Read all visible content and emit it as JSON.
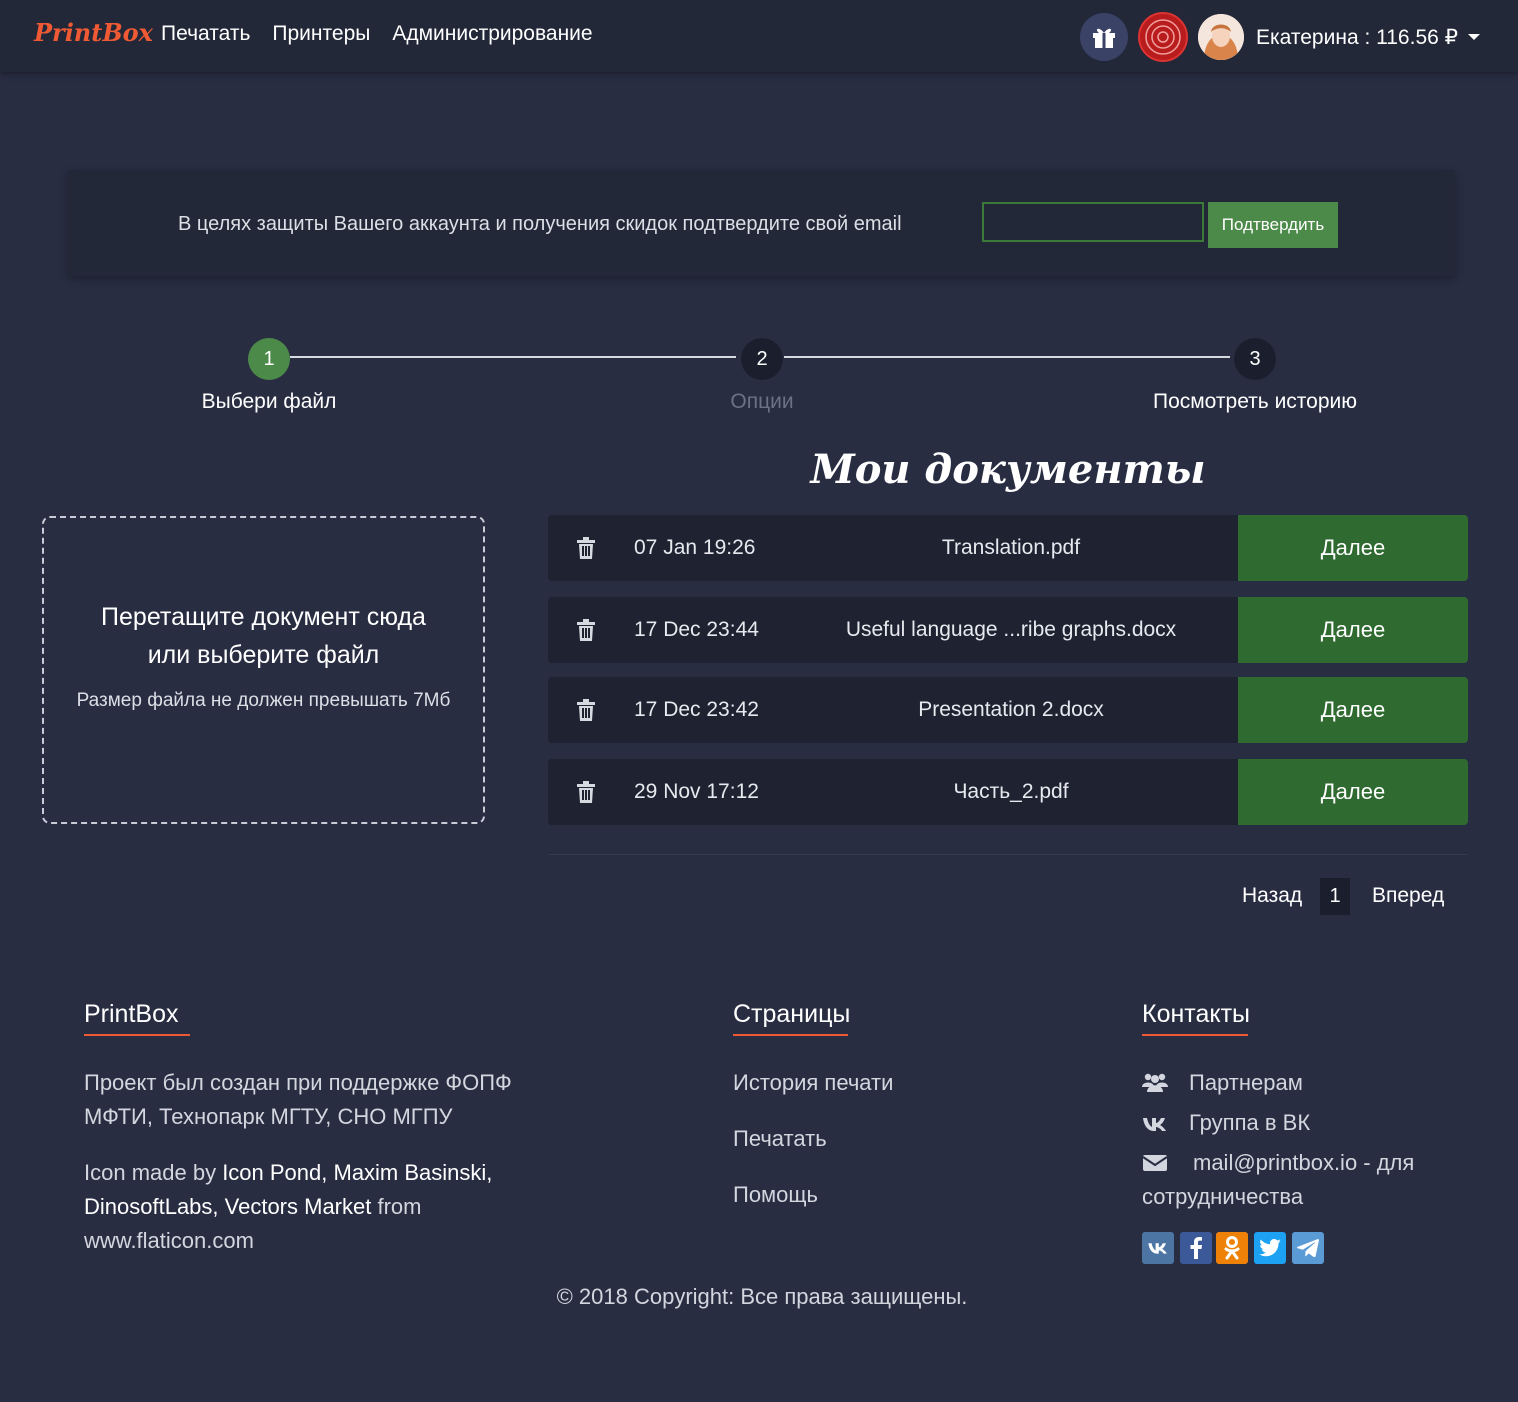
{
  "navbar": {
    "brand": "PrintBox",
    "links": [
      "Печатать",
      "Принтеры",
      "Администрирование"
    ],
    "user_label": "Екатерина : 116.56 ₽",
    "seal_text": "ТЕХНОПАРК"
  },
  "email_alert": {
    "message": "В целях защиты Вашего аккаунта и получения скидок подтвердите свой email",
    "input_value": "",
    "confirm_label": "Подтвердить"
  },
  "stepper": {
    "steps": [
      {
        "number": "1",
        "label": "Выбери файл",
        "state": "active"
      },
      {
        "number": "2",
        "label": "Опции",
        "state": "inactive"
      },
      {
        "number": "3",
        "label": "Посмотреть историю",
        "state": "default"
      }
    ],
    "active_color": "#4c8a49"
  },
  "dropzone": {
    "line1": "Перетащите документ сюда",
    "line2": "или выберите файл",
    "note": "Размер файла не должен превышать 7Мб"
  },
  "documents": {
    "title": "Мои документы",
    "next_label": "Далее",
    "rows": [
      {
        "date": "07 Jan 19:26",
        "name": "Translation.pdf"
      },
      {
        "date": "17 Dec 23:44",
        "name": "Useful language ...ribe graphs.docx"
      },
      {
        "date": "17 Dec 23:42",
        "name": "Presentation 2.docx"
      },
      {
        "date": "29 Nov 17:12",
        "name": "Часть_2.pdf"
      }
    ]
  },
  "pagination": {
    "prev": "Назад",
    "current": "1",
    "next": "Вперед"
  },
  "footer": {
    "about": {
      "title": "PrintBox",
      "text_line1": "Проект был создан при поддержке ФОПФ",
      "text_line2": "МФТИ, Технопарк МГТУ, СНО МГПУ",
      "credit_prefix": "Icon made by ",
      "credit_authors1": "Icon Pond, Maxim Basinski,",
      "credit_authors2": "DinosoftLabs, Vectors Market",
      "credit_from": " from",
      "credit_site": "www.flaticon.com"
    },
    "pages": {
      "title": "Страницы",
      "links": [
        "История печати",
        "Печатать",
        "Помощь"
      ]
    },
    "contacts": {
      "title": "Контакты",
      "partners": "Партнерам",
      "vk_group": "Группа в ВК",
      "email_line1": "mail@printbox.io - для",
      "email_line2": "сотрудничества"
    },
    "copyright": "© 2018 Copyright: Все права защищены.",
    "social_colors": {
      "vk": "#4c75a3",
      "facebook": "#3b5998",
      "ok": "#ee8208",
      "twitter": "#1da1f2",
      "telegram": "#5b9bd5"
    }
  }
}
